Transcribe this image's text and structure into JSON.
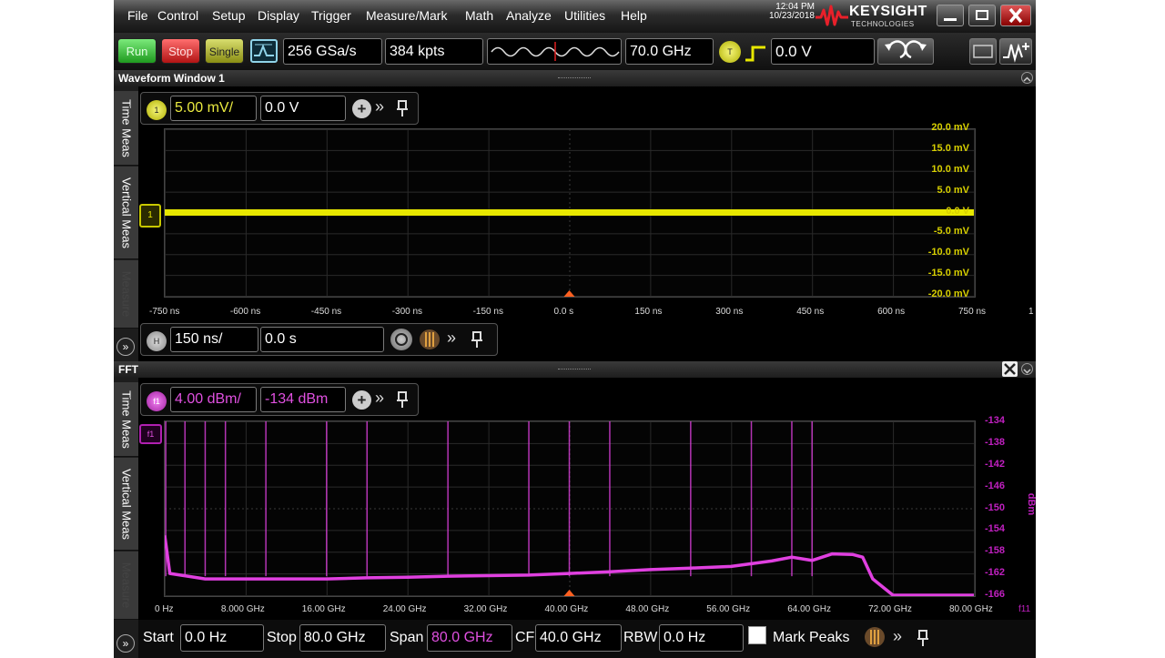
{
  "menu": [
    "File",
    "Control",
    "Setup",
    "Display",
    "Trigger",
    "Measure/Mark",
    "Math",
    "Analyze",
    "Utilities",
    "Help"
  ],
  "clock": {
    "time": "12:04 PM",
    "date": "10/23/2018"
  },
  "brand": {
    "name": "KEYSIGHT",
    "sub": "TECHNOLOGIES"
  },
  "toolbar": {
    "run_label": "Run",
    "stop_label": "Stop",
    "single_label": "Single",
    "sample_rate": "256 GSa/s",
    "memory_depth": "384 kpts",
    "bandwidth": "70.0 GHz",
    "trigger_badge": "T",
    "trigger_level": "0.0 V"
  },
  "window1": {
    "title": "Waveform Window 1",
    "tabs": [
      "Time Meas",
      "Vertical Meas",
      "Measure"
    ],
    "channel_badge": "1",
    "vertical_scale": "5.00 mV/",
    "vertical_offset": "0.0 V",
    "y_ticks": [
      "20.0 mV",
      "15.0 mV",
      "10.0 mV",
      "5.0 mV",
      "0.0 V",
      "-5.0 mV",
      "-10.0 mV",
      "-15.0 mV",
      "-20.0 mV"
    ],
    "x_ticks": [
      "-750 ns",
      "-600 ns",
      "-450 ns",
      "-300 ns",
      "-150 ns",
      "0.0 s",
      "150 ns",
      "300 ns",
      "450 ns",
      "600 ns",
      "750 ns"
    ],
    "right_edge_label": "1",
    "trace_color": "#e8e800"
  },
  "horizontal": {
    "badge": "H",
    "time_scale": "150 ns/",
    "time_delay": "0.0 s"
  },
  "fft": {
    "title": "FFT",
    "tabs": [
      "Time Meas",
      "Vertical Meas",
      "Measure"
    ],
    "func_badge": "f1",
    "vertical_scale": "4.00 dBm/",
    "vertical_offset": "-134 dBm",
    "trace_label": "f1",
    "y_ticks": [
      "-134",
      "-138",
      "-142",
      "-146",
      "-150",
      "-154",
      "-158",
      "-162",
      "-166"
    ],
    "y_unit": "dBm",
    "x_ticks": [
      "0 Hz",
      "8.000 GHz",
      "16.00 GHz",
      "24.00 GHz",
      "32.00 GHz",
      "40.00 GHz",
      "48.00 GHz",
      "56.00 GHz",
      "64.00 GHz",
      "72.00 GHz",
      "80.00 GHz"
    ],
    "right_edge_label": "f11",
    "trace_color": "#e040e0"
  },
  "fft_controls": {
    "start_label": "Start",
    "start_value": "0.0 Hz",
    "stop_label": "Stop",
    "stop_value": "80.0 GHz",
    "span_label": "Span",
    "span_value": "80.0 GHz",
    "cf_label": "CF",
    "cf_value": "40.0 GHz",
    "rbw_label": "RBW",
    "rbw_value": "0.0 Hz",
    "mark_peaks_label": "Mark Peaks"
  },
  "chart_data": [
    {
      "type": "line",
      "x": [
        -750,
        -600,
        -450,
        -300,
        -150,
        0,
        150,
        300,
        450,
        600,
        750
      ],
      "series": [
        {
          "values": [
            0,
            0,
            0,
            0,
            0,
            0,
            0,
            0,
            0,
            0,
            0
          ]
        }
      ],
      "xlim": [
        -750,
        750
      ],
      "ylim": [
        -20,
        20
      ],
      "grid": true
    },
    {
      "type": "line",
      "x": [
        0,
        0.5,
        4,
        8,
        12,
        16,
        20,
        24,
        28,
        32,
        36,
        40,
        44,
        48,
        52,
        56,
        60,
        62,
        64,
        66,
        68,
        69,
        70,
        72,
        76,
        80
      ],
      "series": [
        {
          "values": [
            -155,
            -162,
            -163,
            -163,
            -163,
            -163,
            -162.8,
            -162.7,
            -162.5,
            -162.4,
            -162.3,
            -162,
            -161.7,
            -161.3,
            -161,
            -160.7,
            -159.7,
            -159,
            -159.6,
            -158.4,
            -158.5,
            -159,
            -163,
            -166,
            -166,
            -166
          ]
        }
      ],
      "xlim": [
        0,
        80
      ],
      "ylim": [
        -166,
        -134
      ],
      "grid": true
    }
  ]
}
